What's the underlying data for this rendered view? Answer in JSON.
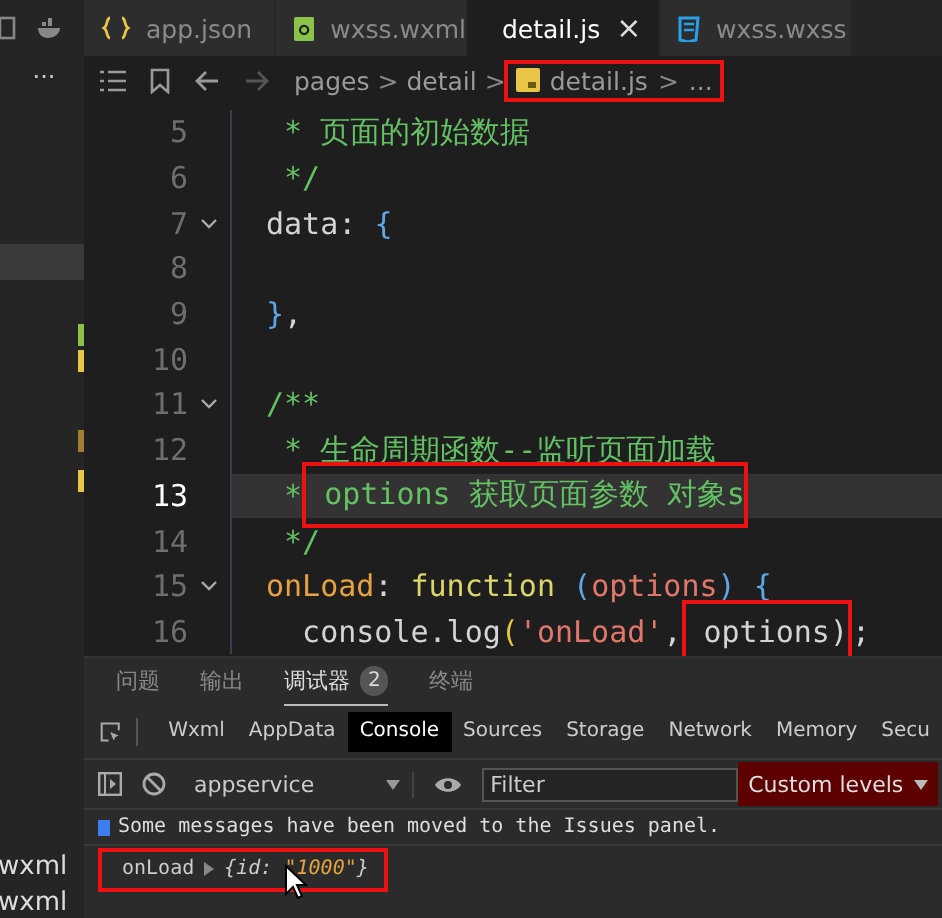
{
  "sidebar": {
    "more": "...",
    "items": [
      {
        "label": "wxml"
      },
      {
        "label": "wxml"
      }
    ]
  },
  "tabs": [
    {
      "label": "app.json",
      "selected": false
    },
    {
      "label": "wxss.wxml",
      "selected": false
    },
    {
      "label": "detail.js",
      "selected": true,
      "close": "×"
    },
    {
      "label": "wxss.wxss",
      "selected": false
    }
  ],
  "breadcrumb": {
    "parts": [
      "pages",
      "detail"
    ],
    "separator": ">",
    "file": "detail.js",
    "tail": "...",
    "boxed": true
  },
  "code": {
    "lines": [
      {
        "number": "5",
        "active": false,
        "foldable": false,
        "tokens": [
          {
            "text": " * 页面的初始数据",
            "kind": "comment",
            "boxed": false
          }
        ]
      },
      {
        "number": "6",
        "active": false,
        "foldable": false,
        "tokens": [
          {
            "text": " */",
            "kind": "comment",
            "boxed": false
          }
        ]
      },
      {
        "number": "7",
        "active": false,
        "foldable": true,
        "tokens": [
          {
            "text": "data",
            "kind": "plain",
            "boxed": false
          },
          {
            "text": ": ",
            "kind": "plain",
            "boxed": false
          },
          {
            "text": "{",
            "kind": "brace",
            "boxed": false
          }
        ]
      },
      {
        "number": "8",
        "active": false,
        "foldable": false
      },
      {
        "number": "9",
        "active": false,
        "foldable": false,
        "tokens": [
          {
            "text": "}",
            "kind": "brace",
            "boxed": false
          },
          {
            "text": ",",
            "kind": "plain",
            "boxed": false
          }
        ]
      },
      {
        "number": "10",
        "active": false,
        "foldable": false
      },
      {
        "number": "11",
        "active": false,
        "foldable": true,
        "tokens": [
          {
            "text": "/**",
            "kind": "comment",
            "boxed": false
          }
        ]
      },
      {
        "number": "12",
        "active": false,
        "foldable": false,
        "tokens": [
          {
            "text": " * 生命周期函数--监听页面加载",
            "kind": "comment",
            "boxed": false
          }
        ]
      },
      {
        "number": "13",
        "active": true,
        "foldable": false,
        "tokens": [
          {
            "text": " *",
            "kind": "comment",
            "boxed": false
          },
          {
            "text": " options 获取页面参数 对象s",
            "kind": "comment",
            "boxed": true
          }
        ]
      },
      {
        "number": "14",
        "active": false,
        "foldable": false,
        "tokens": [
          {
            "text": " */",
            "kind": "comment",
            "boxed": false
          }
        ]
      },
      {
        "number": "15",
        "active": false,
        "foldable": true,
        "tokens": [
          {
            "text": "onLoad",
            "kind": "key",
            "boxed": false
          },
          {
            "text": ": ",
            "kind": "plain",
            "boxed": false
          },
          {
            "text": "function",
            "kind": "keyword",
            "boxed": false
          },
          {
            "text": " (",
            "kind": "brace",
            "boxed": false
          },
          {
            "text": "options",
            "kind": "param",
            "boxed": false
          },
          {
            "text": ")",
            "kind": "brace",
            "boxed": false
          },
          {
            "text": " {",
            "kind": "brace",
            "boxed": false
          }
        ]
      },
      {
        "number": "16",
        "active": false,
        "foldable": false,
        "tokens": [
          {
            "text": "  console.log",
            "kind": "plain",
            "boxed": false
          },
          {
            "text": "(",
            "kind": "paren",
            "boxed": false
          },
          {
            "text": "'onLoad'",
            "kind": "string",
            "boxed": false
          },
          {
            "text": ",",
            "kind": "plain",
            "boxed": false
          },
          {
            "text": " options)",
            "kind": "plain",
            "boxed": true
          },
          {
            "text": ";",
            "kind": "plain",
            "boxed": false
          }
        ]
      }
    ]
  },
  "panel_tabs": [
    {
      "label": "问题",
      "selected": false
    },
    {
      "label": "输出",
      "selected": false
    },
    {
      "label": "调试器",
      "selected": true,
      "badge": "2"
    },
    {
      "label": "终端",
      "selected": false
    }
  ],
  "devtools": {
    "tabs": [
      {
        "label": "Wxml",
        "selected": false
      },
      {
        "label": "AppData",
        "selected": false
      },
      {
        "label": "Console",
        "selected": true
      },
      {
        "label": "Sources",
        "selected": false
      },
      {
        "label": "Storage",
        "selected": false
      },
      {
        "label": "Network",
        "selected": false
      },
      {
        "label": "Memory",
        "selected": false
      },
      {
        "label": "Secu",
        "selected": false
      }
    ],
    "context": "appservice",
    "filter": {
      "placeholder": "Filter"
    },
    "levels": "Custom levels",
    "info": "Some messages have been moved to the Issues panel.",
    "log": {
      "label": "onLoad",
      "open": "{id: ",
      "value": "\"1000\"",
      "close": "}",
      "boxed": true
    }
  }
}
